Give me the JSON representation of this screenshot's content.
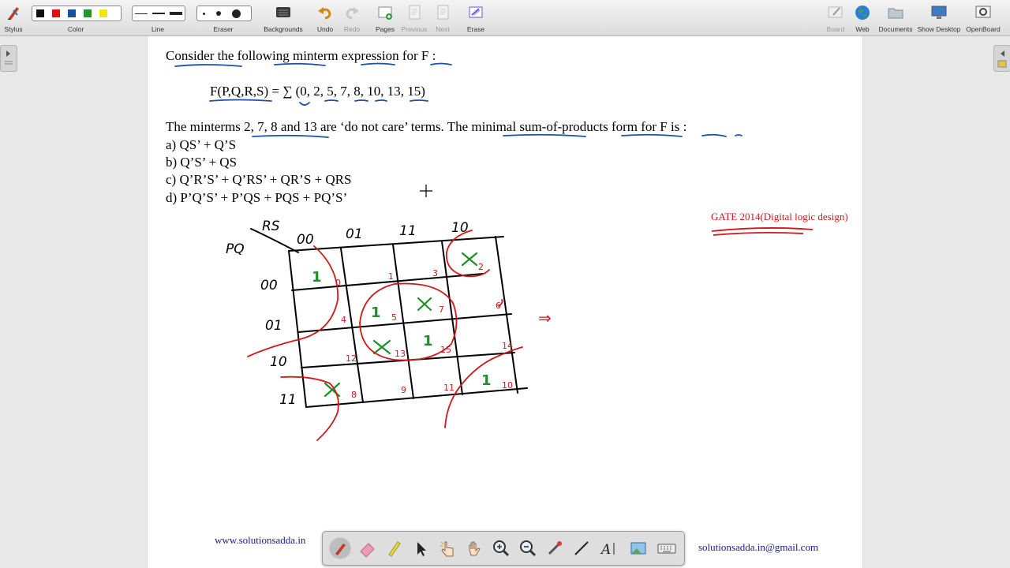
{
  "toolbar": {
    "stylus": "Stylus",
    "color": "Color",
    "line": "Line",
    "eraser": "Eraser",
    "backgrounds": "Backgrounds",
    "undo": "Undo",
    "redo": "Redo",
    "pages": "Pages",
    "previous": "Previous",
    "next": "Next",
    "erase": "Erase",
    "board": "Board",
    "web": "Web",
    "documents": "Documents",
    "show_desktop": "Show Desktop",
    "openboard": "OpenBoard",
    "colors": [
      "#111111",
      "#e01010",
      "#1c4fa0",
      "#1f9a2a",
      "#f4e21a"
    ]
  },
  "board": {
    "line1": "Consider the following minterm expression for F :",
    "line2": "F(P,Q,R,S) = ∑ (0, 2, 5, 7, 8, 10, 13, 15)",
    "line3": "The minterms 2, 7, 8 and 13 are ‘do not care’ terms. The minimal sum-of-products form for F is :",
    "opt_a": "a) QS’ + Q’S",
    "opt_b": "b) Q’S’ + QS",
    "opt_c": "c) Q’R’S’ + Q’RS’ + QR’S + QRS",
    "opt_d": "d) P’Q’S’ + P’QS + PQS + PQ’S’",
    "gate_note": "GATE 2014(Digital logic design)"
  },
  "kmap": {
    "pq": "PQ",
    "rs": "RS",
    "cols": [
      "00",
      "01",
      "11",
      "10"
    ],
    "rows": [
      "00",
      "01",
      "10",
      "11"
    ],
    "cell_numbers": [
      "0",
      "1",
      "3",
      "2",
      "4",
      "5",
      "7",
      "6",
      "12",
      "13",
      "15",
      "14",
      "8",
      "9",
      "11",
      "10"
    ],
    "ones": [
      "1",
      "1",
      "1",
      "1"
    ],
    "arrow": "⇒"
  },
  "footer": {
    "website": "www.solutionsadda.in",
    "email": "solutionsadda.in@gmail.com"
  }
}
